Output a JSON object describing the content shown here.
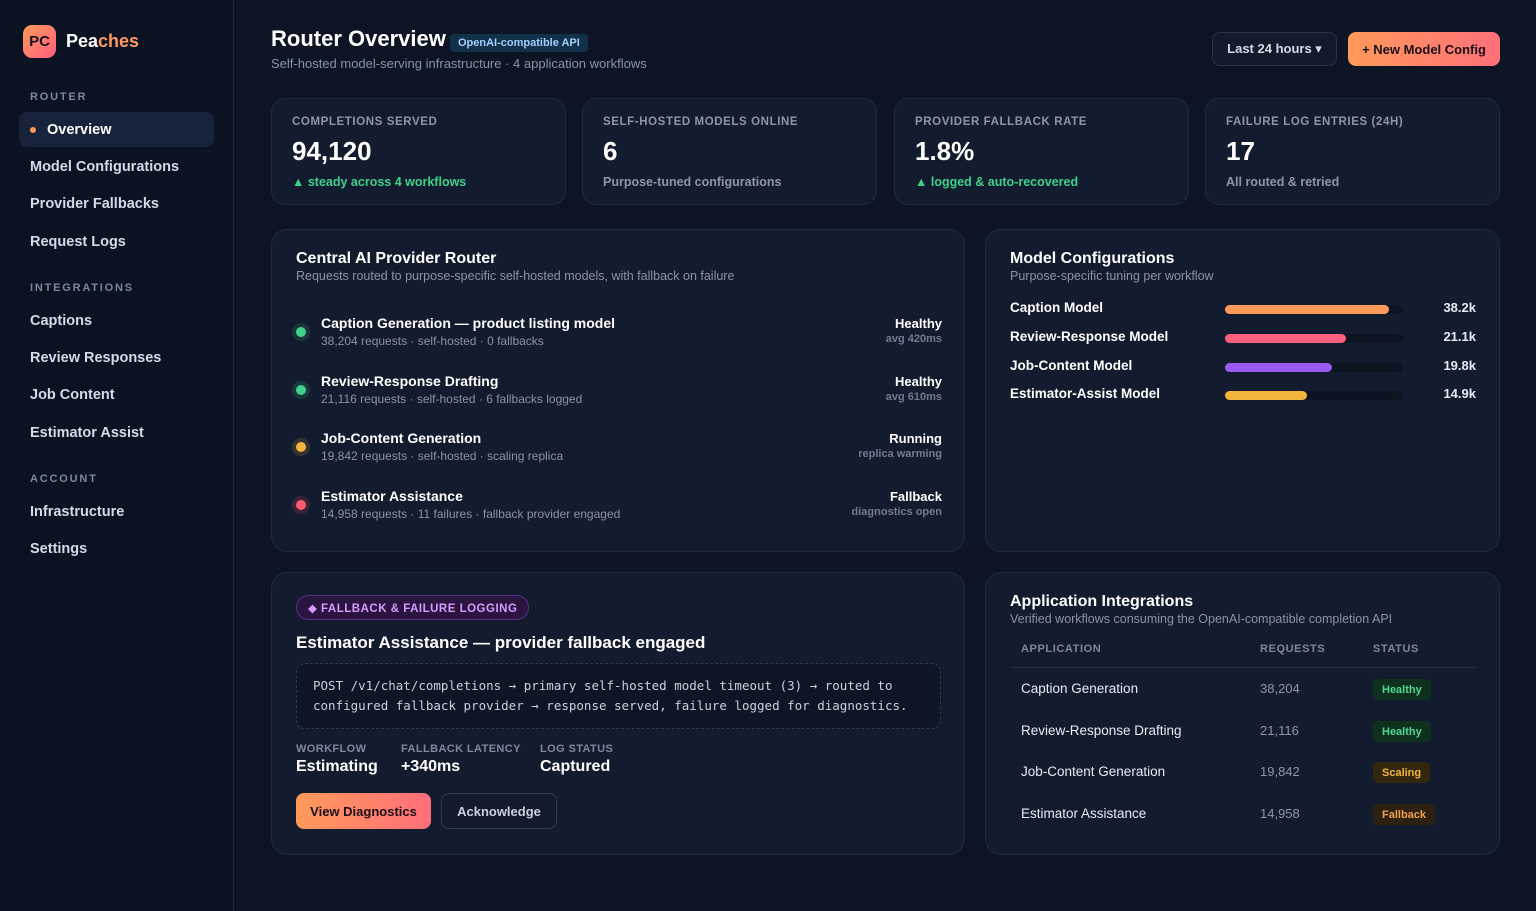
{
  "brand": {
    "logo_text": "PC",
    "name_part1": "Pea",
    "name_part2": "ches"
  },
  "nav": {
    "sections": {
      "router": "ROUTER",
      "integrations": "INTEGRATIONS",
      "account": "ACCOUNT"
    },
    "router_items": [
      "Overview",
      "Model Configurations",
      "Provider Fallbacks",
      "Request Logs"
    ],
    "integration_items": [
      "Captions",
      "Review Responses",
      "Job Content",
      "Estimator Assist"
    ],
    "account_items": [
      "Infrastructure",
      "Settings"
    ],
    "active": "Overview"
  },
  "header": {
    "title": "Router Overview",
    "badge": "OpenAI-compatible API",
    "subtitle": "Self-hosted model-serving infrastructure · 4 application workflows",
    "range_label": "Last 24 hours ▾",
    "new_button": "+ New Model Config"
  },
  "stats": [
    {
      "label": "COMPLETIONS SERVED",
      "value": "94,120",
      "note": "▲ steady across 4 workflows",
      "note_color": "green"
    },
    {
      "label": "SELF-HOSTED MODELS ONLINE",
      "value": "6",
      "note": "Purpose-tuned configurations",
      "note_color": "muted"
    },
    {
      "label": "PROVIDER FALLBACK RATE",
      "value": "1.8%",
      "note": "▲ logged & auto-recovered",
      "note_color": "green"
    },
    {
      "label": "FAILURE LOG ENTRIES (24H)",
      "value": "17",
      "note": "All routed & retried",
      "note_color": "muted"
    }
  ],
  "router": {
    "title": "Central AI Provider Router",
    "subtitle": "Requests routed to purpose-specific self-hosted models, with fallback on failure",
    "routes": [
      {
        "name": "Caption Generation — product listing model",
        "meta": "38,204 requests · self-hosted · 0 fallbacks",
        "status": "Healthy",
        "substatus": "avg 420ms",
        "color": "#3fd18b"
      },
      {
        "name": "Review-Response Drafting",
        "meta": "21,116 requests · self-hosted · 6 fallbacks logged",
        "status": "Healthy",
        "substatus": "avg 610ms",
        "color": "#3fd18b"
      },
      {
        "name": "Job-Content Generation",
        "meta": "19,842 requests · self-hosted · scaling replica",
        "status": "Running",
        "substatus": "replica warming",
        "color": "#f2b43c"
      },
      {
        "name": "Estimator Assistance",
        "meta": "14,958 requests · 11 failures · fallback provider engaged",
        "status": "Fallback",
        "substatus": "diagnostics open",
        "color": "#ff5a6e"
      }
    ]
  },
  "models": {
    "title": "Model Configurations",
    "subtitle": "Purpose-specific tuning per workflow",
    "items": [
      {
        "name": "Caption Model",
        "value": "38.2k",
        "fraction": 0.92,
        "color": "#ff9a5a"
      },
      {
        "name": "Review-Response Model",
        "value": "21.1k",
        "fraction": 0.68,
        "color": "#ff5f7e"
      },
      {
        "name": "Job-Content Model",
        "value": "19.8k",
        "fraction": 0.6,
        "color": "#9a5cf0"
      },
      {
        "name": "Estimator-Assist Model",
        "value": "14.9k",
        "fraction": 0.46,
        "color": "#f2b43c"
      }
    ]
  },
  "fallback": {
    "tag": "◆ FALLBACK & FAILURE LOGGING",
    "title": "Estimator Assistance — provider fallback engaged",
    "code_line1": "POST /v1/chat/completions → primary self-hosted model timeout (3) → routed to",
    "code_line2": "configured fallback provider → response served, failure logged for diagnostics.",
    "workflow_label": "WORKFLOW",
    "workflow_value": "Estimating",
    "latency_label": "FALLBACK LATENCY",
    "latency_value": "+340ms",
    "log_label": "LOG STATUS",
    "log_value": "Captured",
    "primary_button": "View Diagnostics",
    "secondary_button": "Acknowledge"
  },
  "integrations": {
    "title": "Application Integrations",
    "subtitle": "Verified workflows consuming the OpenAI-compatible completion API",
    "columns": [
      "APPLICATION",
      "REQUESTS",
      "STATUS"
    ],
    "rows": [
      {
        "app": "Caption Generation",
        "requests": "38,204",
        "status": "Healthy",
        "kind": "healthy"
      },
      {
        "app": "Review-Response Drafting",
        "requests": "21,116",
        "status": "Healthy",
        "kind": "healthy"
      },
      {
        "app": "Job-Content Generation",
        "requests": "19,842",
        "status": "Scaling",
        "kind": "scaling"
      },
      {
        "app": "Estimator Assistance",
        "requests": "14,958",
        "status": "Fallback",
        "kind": "fallback"
      }
    ]
  }
}
